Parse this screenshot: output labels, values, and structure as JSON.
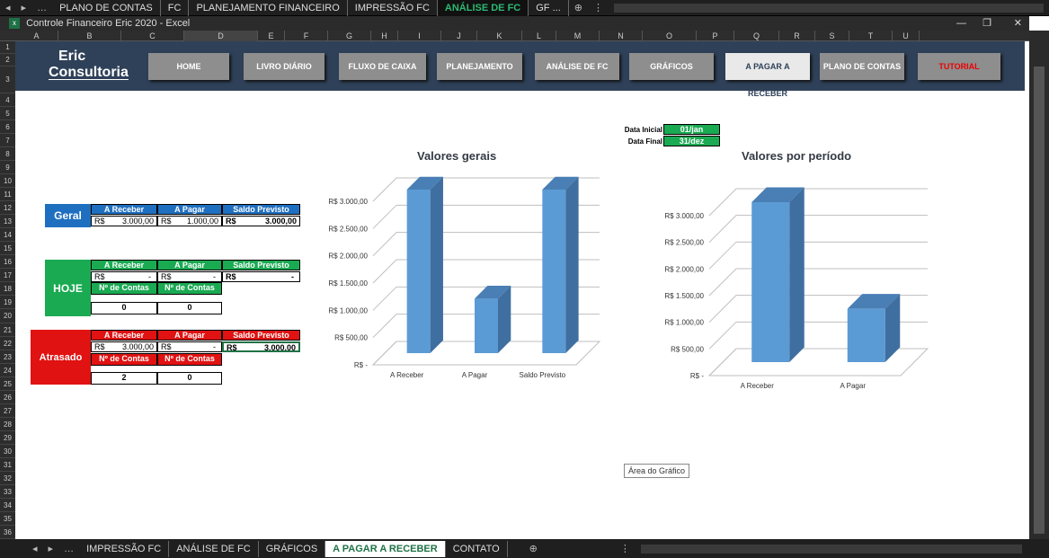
{
  "workbook_tabs_top": [
    "PLANO DE CONTAS",
    "FC",
    "PLANEJAMENTO FINANCEIRO",
    "IMPRESSÃO FC",
    "ANÁLISE DE FC",
    "GF ..."
  ],
  "window": {
    "title": "Controle Financeiro Eric 2020 - Excel"
  },
  "columns": [
    "A",
    "B",
    "C",
    "D",
    "E",
    "F",
    "G",
    "H",
    "I",
    "J",
    "K",
    "L",
    "M",
    "N",
    "O",
    "P",
    "Q",
    "R",
    "S",
    "T",
    "U"
  ],
  "rows": [
    "1",
    "2",
    "3",
    "4",
    "5",
    "6",
    "7",
    "8",
    "9",
    "10",
    "11",
    "12",
    "13",
    "14",
    "15",
    "16",
    "17",
    "18",
    "19",
    "20",
    "21",
    "22",
    "23",
    "24",
    "25",
    "26",
    "27",
    "28",
    "29",
    "30",
    "31",
    "32",
    "33",
    "34",
    "35",
    "36"
  ],
  "logo": {
    "line1": "Eric",
    "line2": "Consultoria"
  },
  "nav": {
    "home": "HOME",
    "livro": "LIVRO DIÁRIO",
    "fluxo": "FLUXO DE CAIXA",
    "planejamento": "PLANEJAMENTO",
    "analise": "ANÁLISE DE FC",
    "graficos": "GRÁFICOS",
    "apagar": "A PAGAR A RECEBER",
    "plano": "PLANO DE CONTAS",
    "tutorial": "TUTORIAL"
  },
  "dates": {
    "inicial_label": "Data Inicial",
    "inicial": "01/jan",
    "final_label": "Data Final",
    "final": "31/dez"
  },
  "geral": {
    "label": "Geral",
    "h1": "A Receber",
    "h2": "A Pagar",
    "h3": "Saldo Previsto",
    "cur": "R$",
    "v1": "3.000,00",
    "v2": "1.000,00",
    "v3": "3.000,00"
  },
  "hoje": {
    "label": "HOJE",
    "h1": "A Receber",
    "h2": "A Pagar",
    "h3": "Saldo Previsto",
    "cur": "R$",
    "v1": "-",
    "v2": "-",
    "v3": "-",
    "c1": "Nº de Contas",
    "c2": "Nº de Contas",
    "n1": "0",
    "n2": "0"
  },
  "atrasado": {
    "label": "Atrasado",
    "h1": "A Receber",
    "h2": "A Pagar",
    "h3": "Saldo Previsto",
    "cur": "R$",
    "v1": "3.000,00",
    "v2": "-",
    "v3": "3.000,00",
    "c1": "Nº de Contas",
    "c2": "Nº de Contas",
    "n1": "2",
    "n2": "0"
  },
  "chart_data": [
    {
      "type": "bar",
      "title": "Valores gerais",
      "categories": [
        "A Receber",
        "A Pagar",
        "Saldo Previsto"
      ],
      "values": [
        3000,
        1000,
        3000
      ],
      "ylim": [
        0,
        3000
      ],
      "yticks": [
        "R$ -",
        "R$ 500,00",
        "R$ 1.000,00",
        "R$ 1.500,00",
        "R$ 2.000,00",
        "R$ 2.500,00",
        "R$ 3.000,00"
      ],
      "color": "#5b9bd5"
    },
    {
      "type": "bar",
      "title": "Valores por período",
      "categories": [
        "A Receber",
        "A Pagar"
      ],
      "values": [
        3000,
        1000
      ],
      "ylim": [
        0,
        3000
      ],
      "yticks": [
        "R$ -",
        "R$ 500,00",
        "R$ 1.000,00",
        "R$ 1.500,00",
        "R$ 2.000,00",
        "R$ 2.500,00",
        "R$ 3.000,00"
      ],
      "color": "#5b9bd5"
    }
  ],
  "tooltip": "Área do Gráfico",
  "workbook_tabs_bottom": [
    "IMPRESSÃO FC",
    "ANÁLISE DE FC",
    "GRÁFICOS",
    "A PAGAR A RECEBER",
    "CONTATO"
  ],
  "colors": {
    "banner": "#2f4159",
    "blue": "#1f6fc0",
    "green": "#1aaa52",
    "red": "#e01212",
    "tab_active": "#2eb872"
  }
}
